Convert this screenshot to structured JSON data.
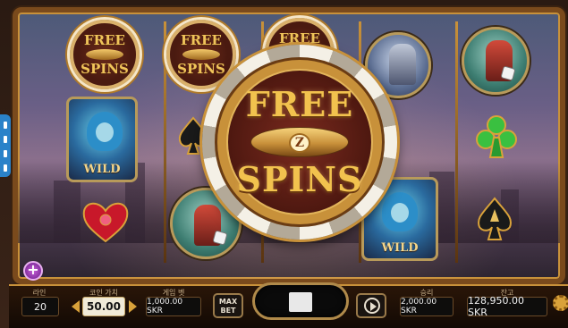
{
  "game": {
    "big_symbol": {
      "line1": "FREE",
      "line2": "SPINS",
      "badge": "Z"
    },
    "small_symbol": {
      "line1": "FREE",
      "line2": "SPINS"
    },
    "wild_label": "WILD"
  },
  "controls": {
    "lines": {
      "label": "라인",
      "value": "20"
    },
    "coin_value": {
      "label": "코인 가치",
      "value": "50.00"
    },
    "bet": {
      "label": "게임 벳",
      "value": "1,000.00 SKR"
    },
    "max_bet": "MAX BET",
    "win": {
      "label": "승리",
      "value": "2,000.00 SKR"
    },
    "balance": {
      "label": "잔고",
      "value": "128,950.00 SKR"
    }
  },
  "colors": {
    "frame_gold": "#c8913a",
    "chip_red": "#7a2a1e",
    "text_gold": "#f2c24e",
    "side_tab": "#2a82c9"
  },
  "icons": [
    "add-icon",
    "stop-icon",
    "autoplay-icon",
    "settings-gear-icon",
    "heart-suit-icon",
    "club-suit-icon",
    "spade-suit-icon",
    "zeppelin-icon"
  ]
}
